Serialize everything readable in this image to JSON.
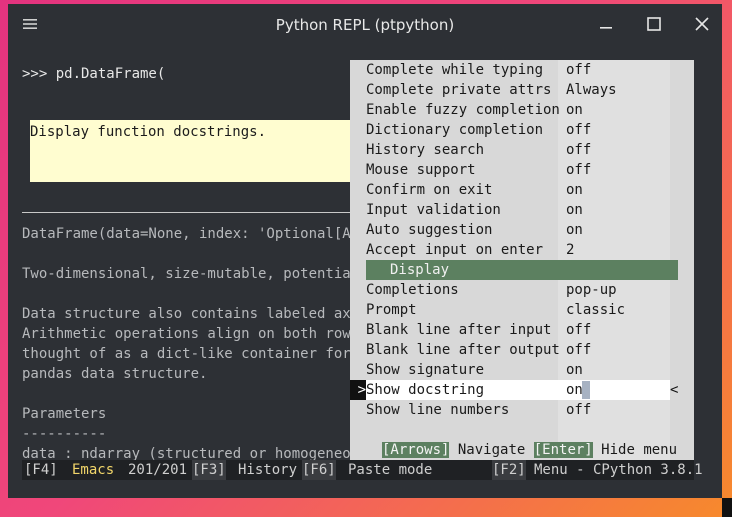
{
  "window": {
    "title": "Python REPL (ptpython)"
  },
  "terminal": {
    "input_line": ">>> pd.DataFrame(",
    "doc_popup_text": "Display function docstrings.",
    "docstring_lines": [
      "DataFrame(data=None, index: 'Optional[Axe",
      "",
      "Two-dimensional, size-mutable, potentiall",
      "",
      "Data structure also contains labeled axes",
      "Arithmetic operations align on both row a",
      "thought of as a dict-like container for S",
      "pandas data structure.",
      "",
      "Parameters",
      "----------",
      "data : ndarray (structured or homogeneous"
    ]
  },
  "menu": {
    "options_top": [
      {
        "key": "Complete while typing",
        "value": "off"
      },
      {
        "key": "Complete private attrs",
        "value": "Always"
      },
      {
        "key": "Enable fuzzy completion",
        "value": "on"
      },
      {
        "key": "Dictionary completion",
        "value": "off"
      },
      {
        "key": "History search",
        "value": "off"
      },
      {
        "key": "Mouse support",
        "value": "off"
      },
      {
        "key": "Confirm on exit",
        "value": "on"
      },
      {
        "key": "Input validation",
        "value": "on"
      },
      {
        "key": "Auto suggestion",
        "value": "on"
      },
      {
        "key": "Accept input on enter",
        "value": "2"
      }
    ],
    "section_header": "Display",
    "options_display": [
      {
        "key": "Completions",
        "value": "pop-up"
      },
      {
        "key": "Prompt",
        "value": "classic"
      },
      {
        "key": "Blank line after input",
        "value": "off"
      },
      {
        "key": "Blank line after output",
        "value": "off"
      },
      {
        "key": "Show signature",
        "value": "on"
      },
      {
        "key": "Show docstring",
        "value": "on"
      },
      {
        "key": "Show line numbers",
        "value": "off"
      }
    ],
    "selected_marker_left": ">",
    "selected_marker_right": "<",
    "hint": {
      "arrows_key": "[Arrows]",
      "arrows_label": " Navigate ",
      "enter_key": "[Enter]",
      "enter_label": " Hide menu"
    }
  },
  "toolbar": {
    "f4": "[F4]",
    "mode": "Emacs",
    "counter": "201/201",
    "f3": "[F3]",
    "history": "History",
    "f6": "[F6]",
    "paste": "Paste mode",
    "f2": "[F2]",
    "menu_info": "Menu - CPython 3.8.1"
  },
  "colors": {
    "terminal_bg": "#2d3035",
    "menu_bg": "#d8d8d8",
    "accent_green": "#5c8060",
    "popup_bg": "#fffdd0",
    "mode_yellow": "#f1d56a"
  }
}
